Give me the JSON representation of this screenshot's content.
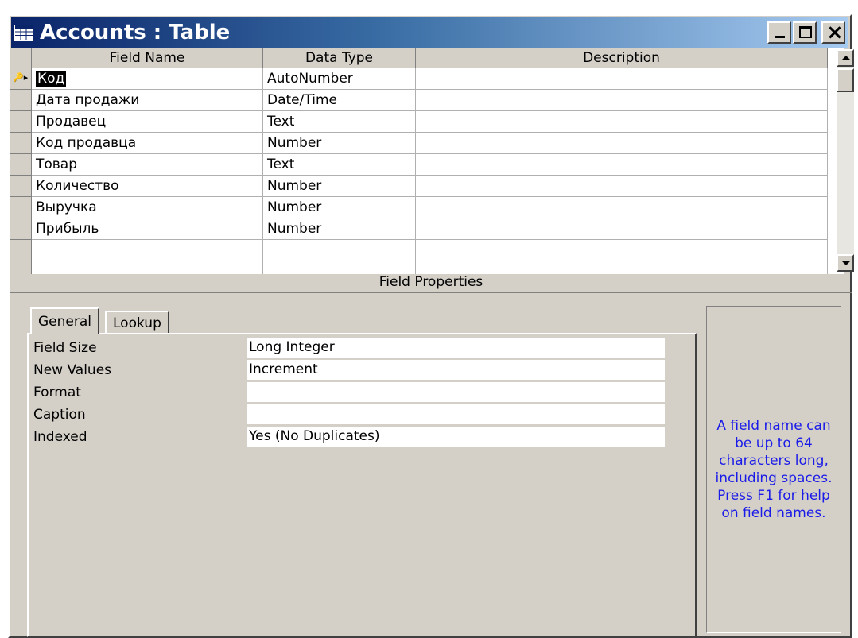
{
  "window": {
    "title": "Accounts : Table",
    "icon": "table-icon",
    "buttons": [
      "minimize-icon",
      "maximize-icon",
      "close-icon"
    ],
    "close_glyph": "×"
  },
  "grid": {
    "columns": [
      "Field Name",
      "Data Type",
      "Description"
    ],
    "rows": [
      {
        "field": "Код",
        "type": "AutoNumber",
        "description": "",
        "primary_key": true,
        "selected": true
      },
      {
        "field": "Дата продажи",
        "type": "Date/Time",
        "description": ""
      },
      {
        "field": "Продавец",
        "type": "Text",
        "description": ""
      },
      {
        "field": "Код продавца",
        "type": "Number",
        "description": ""
      },
      {
        "field": "Товар",
        "type": "Text",
        "description": ""
      },
      {
        "field": "Количество",
        "type": "Number",
        "description": ""
      },
      {
        "field": "Выручка",
        "type": "Number",
        "description": ""
      },
      {
        "field": "Прибыль",
        "type": "Number",
        "description": ""
      },
      {
        "field": "",
        "type": "",
        "description": ""
      }
    ]
  },
  "field_properties": {
    "header": "Field Properties",
    "tabs": [
      "General",
      "Lookup"
    ],
    "active_tab": "General",
    "properties": [
      {
        "label": "Field Size",
        "value": "Long Integer"
      },
      {
        "label": "New Values",
        "value": "Increment"
      },
      {
        "label": "Format",
        "value": ""
      },
      {
        "label": "Caption",
        "value": ""
      },
      {
        "label": "Indexed",
        "value": "Yes (No Duplicates)"
      }
    ],
    "help_text": "A field name can be up to 64 characters long, including spaces.  Press F1 for help on field names.",
    "help_color": "#1c1ce8"
  }
}
